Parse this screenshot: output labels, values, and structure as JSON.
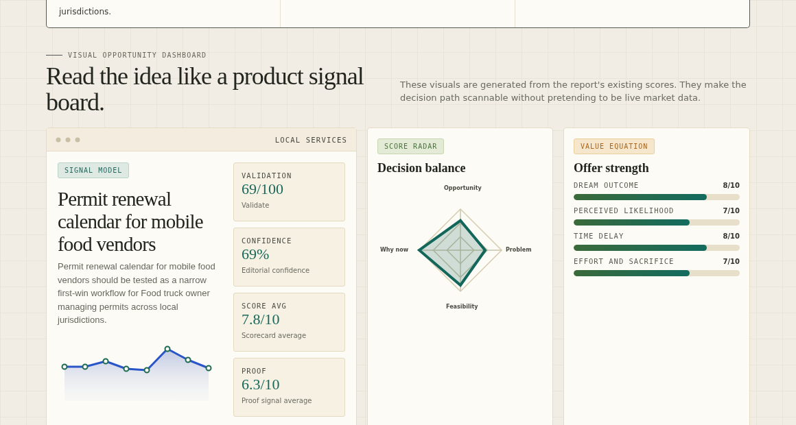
{
  "top_card": {
    "cells": [
      "jurisdictions.",
      "",
      ""
    ]
  },
  "section": {
    "eyebrow": "VISUAL OPPORTUNITY DASHBOARD",
    "heading": "Read the idea like a product signal board.",
    "intro": "These visuals are generated from the report's existing scores. They make the decision path scannable without pretending to be live market data."
  },
  "signal_card": {
    "window_label": "LOCAL SERVICES",
    "tag": "SIGNAL MODEL",
    "title": "Permit renewal calendar for mobile food vendors",
    "summary": "Permit renewal calendar for mobile food vendors should be tested as a narrow first-win workflow for Food truck owner managing permits across local jurisdictions.",
    "metrics": [
      {
        "label": "VALIDATION",
        "value": "69/100",
        "caption": "Validate"
      },
      {
        "label": "CONFIDENCE",
        "value": "69%",
        "caption": "Editorial confidence"
      },
      {
        "label": "SCORE AVG",
        "value": "7.8/10",
        "caption": "Scorecard average"
      },
      {
        "label": "PROOF",
        "value": "6.3/10",
        "caption": "Proof signal average"
      }
    ]
  },
  "radar_card": {
    "tag": "SCORE RADAR",
    "title": "Decision balance",
    "axes": [
      "Opportunity",
      "Problem",
      "Feasibility",
      "Why now"
    ]
  },
  "value_card": {
    "tag": "VALUE EQUATION",
    "title": "Offer strength",
    "bars": [
      {
        "label": "DREAM OUTCOME",
        "score": "8/10",
        "level": 0.8
      },
      {
        "label": "PERCEIVED LIKELIHOOD",
        "score": "7/10",
        "level": 0.7
      },
      {
        "label": "TIME DELAY",
        "score": "8/10",
        "level": 0.8
      },
      {
        "label": "EFFORT AND SACRIFICE",
        "score": "7/10",
        "level": 0.7
      }
    ]
  }
}
